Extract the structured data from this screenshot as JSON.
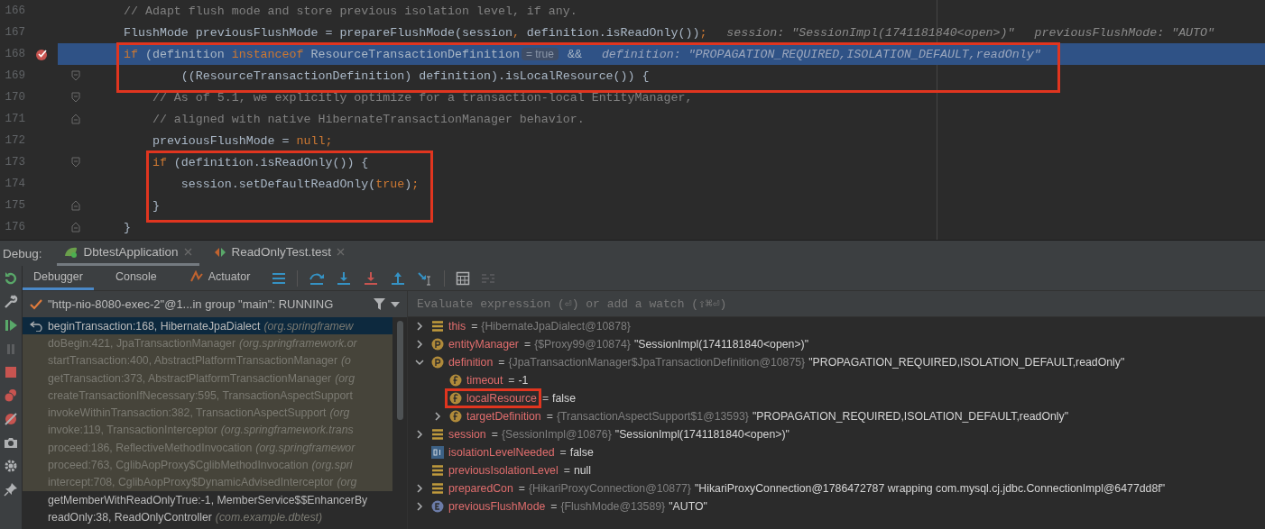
{
  "editor": {
    "lines": [
      {
        "number": "166",
        "breakpoint": false,
        "current": false,
        "fold_start": false,
        "fold_end": false,
        "boxed": false,
        "parts": [
          {
            "kind": "code",
            "tokens": [
              {
                "kind": "comment",
                "t": "// Adapt flush mode and store previous isolation level, if any."
              }
            ]
          }
        ]
      },
      {
        "number": "167",
        "breakpoint": false,
        "current": false,
        "fold_start": false,
        "fold_end": false,
        "boxed": false,
        "parts": [
          {
            "kind": "code",
            "tokens": [
              {
                "kind": "plain",
                "t": "FlushMode previousFlushMode = prepareFlushMode(session"
              },
              {
                "kind": "keyword",
                "t": ","
              },
              {
                "kind": "plain",
                "t": " definition.isReadOnly())"
              },
              {
                "kind": "keyword",
                "t": ";"
              }
            ]
          },
          {
            "kind": "hint",
            "text": "session: \"SessionImpl(1741181840<open>)\""
          },
          {
            "kind": "hint",
            "text": "previousFlushMode: \"AUTO\""
          }
        ]
      },
      {
        "number": "168",
        "breakpoint": true,
        "current": true,
        "fold_start": false,
        "fold_end": false,
        "boxed": true,
        "parts": [
          {
            "kind": "code",
            "tokens": [
              {
                "kind": "keyword",
                "t": "if"
              },
              {
                "kind": "plain",
                "t": " (definition "
              },
              {
                "kind": "keyword",
                "t": "instanceof"
              },
              {
                "kind": "plain",
                "t": " ResourceTransactionDefinition"
              }
            ]
          },
          {
            "kind": "badge",
            "text": "= true"
          },
          {
            "kind": "code",
            "tokens": [
              {
                "kind": "plain",
                "t": "&&"
              }
            ]
          },
          {
            "kind": "hint",
            "text": "definition: \"PROPAGATION_REQUIRED,ISOLATION_DEFAULT,readOnly\""
          }
        ]
      },
      {
        "number": "169",
        "breakpoint": false,
        "current": false,
        "fold_start": true,
        "fold_end": false,
        "boxed": true,
        "parts": [
          {
            "kind": "code",
            "tokens": [
              {
                "kind": "plain",
                "t": "        ((ResourceTransactionDefinition) definition).isLocalResource()) {"
              }
            ]
          }
        ]
      },
      {
        "number": "170",
        "breakpoint": false,
        "current": false,
        "fold_start": true,
        "fold_end": false,
        "boxed": false,
        "parts": [
          {
            "kind": "code",
            "tokens": [
              {
                "kind": "comment",
                "t": "    // As of 5.1, we explicitly optimize for a transaction-local EntityManager,"
              }
            ]
          }
        ]
      },
      {
        "number": "171",
        "breakpoint": false,
        "current": false,
        "fold_start": false,
        "fold_end": true,
        "boxed": false,
        "parts": [
          {
            "kind": "code",
            "tokens": [
              {
                "kind": "comment",
                "t": "    // aligned with native HibernateTransactionManager behavior."
              }
            ]
          }
        ]
      },
      {
        "number": "172",
        "breakpoint": false,
        "current": false,
        "fold_start": false,
        "fold_end": false,
        "boxed": false,
        "parts": [
          {
            "kind": "code",
            "tokens": [
              {
                "kind": "plain",
                "t": "    previousFlushMode = "
              },
              {
                "kind": "keyword",
                "t": "null;"
              }
            ]
          }
        ]
      },
      {
        "number": "173",
        "breakpoint": false,
        "current": false,
        "fold_start": true,
        "fold_end": false,
        "boxed": true,
        "parts": [
          {
            "kind": "code",
            "tokens": [
              {
                "kind": "keyword",
                "t": "    if"
              },
              {
                "kind": "plain",
                "t": " (definition.isReadOnly()) {"
              }
            ]
          }
        ]
      },
      {
        "number": "174",
        "breakpoint": false,
        "current": false,
        "fold_start": false,
        "fold_end": false,
        "boxed": true,
        "parts": [
          {
            "kind": "code",
            "tokens": [
              {
                "kind": "plain",
                "t": "        session.setDefaultReadOnly("
              },
              {
                "kind": "keyword",
                "t": "true"
              },
              {
                "kind": "plain",
                "t": ")"
              },
              {
                "kind": "keyword",
                "t": ";"
              }
            ]
          }
        ]
      },
      {
        "number": "175",
        "breakpoint": false,
        "current": false,
        "fold_start": false,
        "fold_end": true,
        "boxed": true,
        "parts": [
          {
            "kind": "code",
            "tokens": [
              {
                "kind": "plain",
                "t": "    }"
              }
            ]
          }
        ]
      },
      {
        "number": "176",
        "breakpoint": false,
        "current": false,
        "fold_start": false,
        "fold_end": true,
        "boxed": false,
        "parts": [
          {
            "kind": "code",
            "tokens": [
              {
                "kind": "plain",
                "t": "}"
              }
            ]
          }
        ]
      }
    ]
  },
  "debug": {
    "label": "Debug:",
    "tabs": [
      {
        "label": "DbtestApplication",
        "kind": "app",
        "selected": true
      },
      {
        "label": "ReadOnlyTest.test",
        "kind": "test",
        "selected": false
      }
    ],
    "subtabs": [
      {
        "label": "Debugger",
        "selected": true
      },
      {
        "label": "Console",
        "selected": false
      },
      {
        "label": "Actuator",
        "selected": false
      }
    ],
    "thread": "\"http-nio-8080-exec-2\"@1...in group \"main\": RUNNING",
    "frames": [
      {
        "method": "beginTransaction:168, HibernateJpaDialect",
        "package": "(org.springframew",
        "selected": true,
        "library": false
      },
      {
        "method": "doBegin:421, JpaTransactionManager",
        "package": "(org.springframework.or",
        "selected": false,
        "library": true
      },
      {
        "method": "startTransaction:400, AbstractPlatformTransactionManager",
        "package": "(o",
        "selected": false,
        "library": true
      },
      {
        "method": "getTransaction:373, AbstractPlatformTransactionManager",
        "package": "(org",
        "selected": false,
        "library": true
      },
      {
        "method": "createTransactionIfNecessary:595, TransactionAspectSupport",
        "selected": false,
        "library": true
      },
      {
        "method": "invokeWithinTransaction:382, TransactionAspectSupport",
        "package": "(org",
        "selected": false,
        "library": true
      },
      {
        "method": "invoke:119, TransactionInterceptor",
        "package": "(org.springframework.trans",
        "selected": false,
        "library": true
      },
      {
        "method": "proceed:186, ReflectiveMethodInvocation",
        "package": "(org.springframewor",
        "selected": false,
        "library": true
      },
      {
        "method": "proceed:763, CglibAopProxy$CglibMethodInvocation",
        "package": "(org.spri",
        "selected": false,
        "library": true
      },
      {
        "method": "intercept:708, CglibAopProxy$DynamicAdvisedInterceptor",
        "package": "(org",
        "selected": false,
        "library": true
      },
      {
        "method": "getMemberWithReadOnlyTrue:-1, MemberService$$EnhancerBy",
        "selected": false,
        "library": false
      },
      {
        "method": "readOnly:38, ReadOnlyController",
        "package": "(com.example.dbtest)",
        "selected": false,
        "library": false
      }
    ],
    "evaluate": {
      "placeholder": "Evaluate expression (⏎) or add a watch (⇧⌘⏎)"
    },
    "variables": [
      {
        "kind": "field",
        "name": "this",
        "sep": "=",
        "type": "{HibernateJpaDialect@10878}",
        "expanded": false,
        "marked": false
      },
      {
        "kind": "param",
        "name": "entityManager",
        "sep": "=",
        "type": "{$Proxy99@10874}",
        "value": "\"SessionImpl(1741181840<open>)\"",
        "expanded": false,
        "marked": false
      },
      {
        "kind": "param",
        "name": "definition",
        "sep": "=",
        "type": "{JpaTransactionManager$JpaTransactionDefinition@10875}",
        "value": "\"PROPAGATION_REQUIRED,ISOLATION_DEFAULT,readOnly\"",
        "expanded": true,
        "marked": false,
        "children": [
          {
            "kind": "final",
            "name": "timeout",
            "sep": "=",
            "value": "-1",
            "marked": false
          },
          {
            "kind": "final",
            "name": "localResource",
            "sep": "=",
            "value": "false",
            "marked": true
          },
          {
            "kind": "final",
            "name": "targetDefinition",
            "sep": "=",
            "type": "{TransactionAspectSupport$1@13593}",
            "value": "\"PROPAGATION_REQUIRED,ISOLATION_DEFAULT,readOnly\"",
            "expanded": false,
            "marked": false
          }
        ]
      },
      {
        "kind": "field",
        "name": "session",
        "sep": "=",
        "type": "{SessionImpl@10876}",
        "value": "\"SessionImpl(1741181840<open>)\"",
        "expanded": false,
        "marked": false
      },
      {
        "kind": "bool",
        "name": "isolationLevelNeeded",
        "sep": "=",
        "value": "false",
        "marked": false
      },
      {
        "kind": "field",
        "name": "previousIsolationLevel",
        "sep": "=",
        "value": "null",
        "marked": false
      },
      {
        "kind": "field",
        "name": "preparedCon",
        "sep": "=",
        "type": "{HikariProxyConnection@10877}",
        "value": "\"HikariProxyConnection@1786472787 wrapping com.mysql.cj.jdbc.ConnectionImpl@6477dd8f\"",
        "expanded": false,
        "marked": false
      },
      {
        "kind": "enum",
        "name": "previousFlushMode",
        "sep": "=",
        "type": "{FlushMode@13589}",
        "value": "\"AUTO\"",
        "expanded": false,
        "marked": false
      }
    ]
  }
}
